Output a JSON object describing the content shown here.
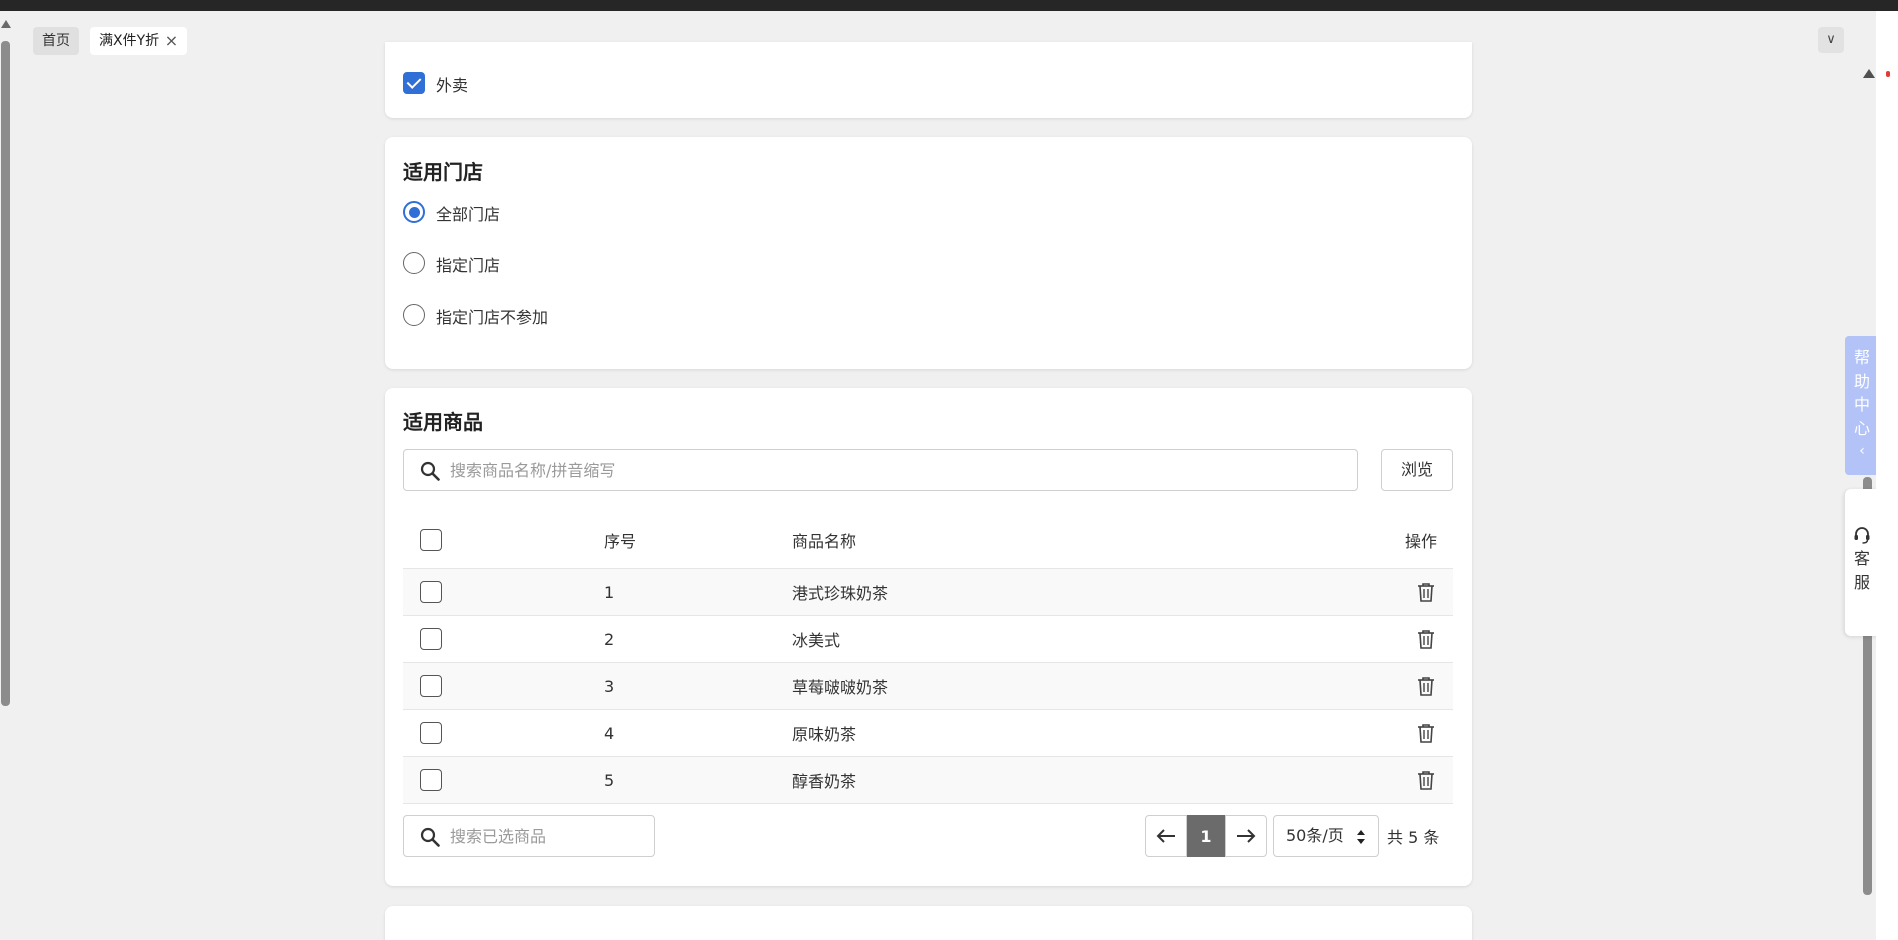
{
  "tabs": {
    "home": "首页",
    "active": "满X件Y折",
    "close_glyph": "×",
    "menu_glyph": "∨"
  },
  "delivery": {
    "label": "外卖",
    "checked": true
  },
  "stores": {
    "title": "适用门店",
    "options": [
      "全部门店",
      "指定门店",
      "指定门店不参加"
    ],
    "selected": 0
  },
  "products": {
    "title": "适用商品",
    "search_placeholder": "搜索商品名称/拼音缩写",
    "browse_label": "浏览",
    "columns": {
      "index": "序号",
      "name": "商品名称",
      "action": "操作"
    },
    "rows": [
      {
        "index": "1",
        "name": "港式珍珠奶茶"
      },
      {
        "index": "2",
        "name": "冰美式"
      },
      {
        "index": "3",
        "name": "草莓啵啵奶茶"
      },
      {
        "index": "4",
        "name": "原味奶茶"
      },
      {
        "index": "5",
        "name": "醇香奶茶"
      }
    ],
    "selected_search_placeholder": "搜索已选商品",
    "pagination": {
      "current_page": "1",
      "per_page": "50条/页",
      "total": "共 5 条"
    }
  },
  "side": {
    "help_chars": [
      "帮",
      "助",
      "中",
      "心"
    ],
    "help_chevron": "‹",
    "service_chars": [
      "客",
      "服"
    ]
  },
  "colors": {
    "accent": "#2f6fd6",
    "help_bg": "#b3c3f7",
    "pager_active": "#6b6b6b"
  }
}
